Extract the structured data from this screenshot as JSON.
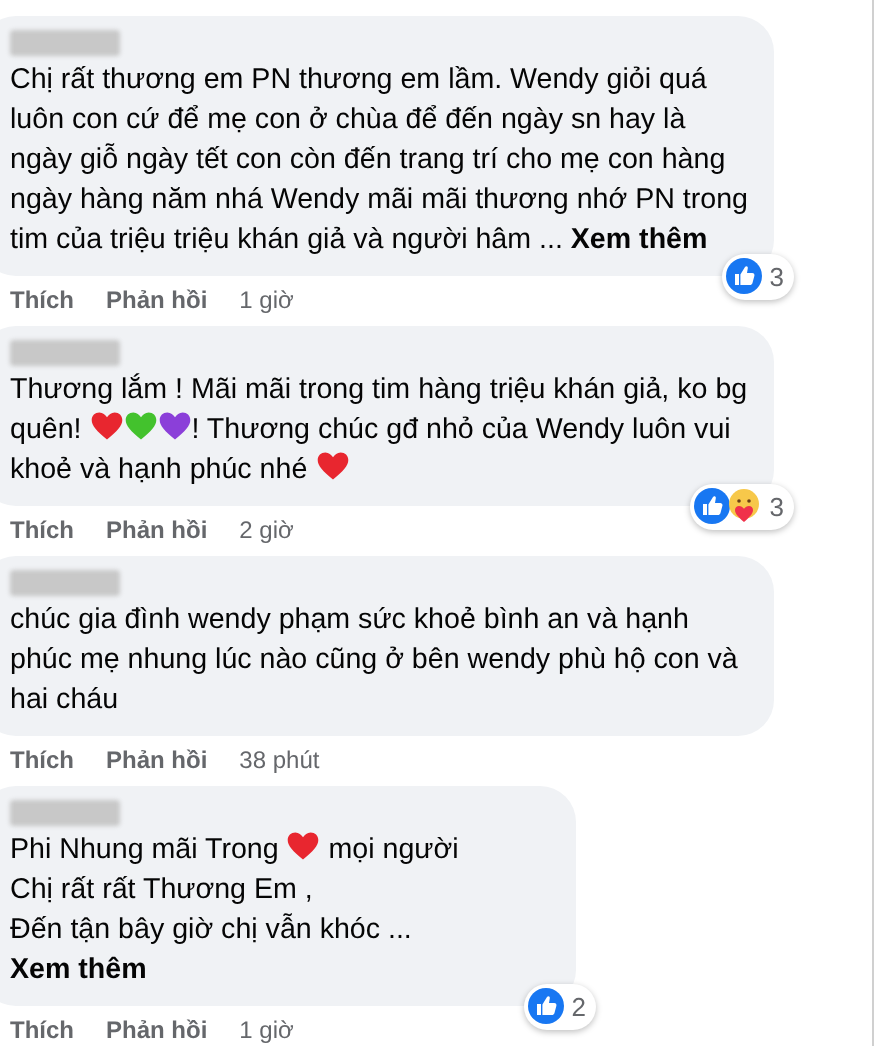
{
  "comments": [
    {
      "content": [
        {
          "kind": "text",
          "text": "Chị rất thương em PN thương em lầm. Wendy giỏi quá luôn con cứ để mẹ con ở chùa để đến ngày sn hay là ngày giỗ ngày tết con còn đến trang trí cho mẹ con hàng ngày hàng năm nhá Wendy mãi mãi thương nhớ PN trong tim của triệu triệu khán giả và người hâm ... "
        },
        {
          "kind": "more",
          "text": "Xem thêm"
        }
      ],
      "actions": [
        "Thích",
        "Phản hồi"
      ],
      "time": "1 giờ",
      "reactions": {
        "icons": [
          {
            "kind": "like"
          }
        ],
        "count": "3"
      }
    },
    {
      "content": [
        {
          "kind": "text",
          "text": "Thương lắm ! Mãi mãi trong tim hàng triệu khán giả, ko bg quên! "
        },
        {
          "kind": "heart",
          "color": "#e8262f"
        },
        {
          "kind": "heart",
          "color": "#43c22d"
        },
        {
          "kind": "heart",
          "color": "#8b3fd9"
        },
        {
          "kind": "text",
          "text": "! Thương chúc gđ nhỏ của Wendy luôn vui khoẻ và hạnh phúc nhé "
        },
        {
          "kind": "heart",
          "color": "#e8262f"
        }
      ],
      "actions": [
        "Thích",
        "Phản hồi"
      ],
      "time": "2 giờ",
      "reactions": {
        "icons": [
          {
            "kind": "like"
          },
          {
            "kind": "care"
          }
        ],
        "count": "3"
      }
    },
    {
      "content": [
        {
          "kind": "text",
          "text": "chúc gia đình wendy phạm sức khoẻ bình an và hạnh phúc mẹ nhung lúc nào cũng ở bên wendy phù hộ con và hai cháu"
        }
      ],
      "actions": [
        "Thích",
        "Phản hồi"
      ],
      "time": "38 phút"
    },
    {
      "content": [
        {
          "kind": "text",
          "text": "Phi Nhung mãi Trong "
        },
        {
          "kind": "heart",
          "color": "#e8262f"
        },
        {
          "kind": "text",
          "text": " mọi người"
        },
        {
          "kind": "break"
        },
        {
          "kind": "text",
          "text": "Chị rất rất Thương Em ,"
        },
        {
          "kind": "break"
        },
        {
          "kind": "text",
          "text": "Đến tận bây giờ chị vẫn khóc ... "
        },
        {
          "kind": "more",
          "text": "Xem thêm"
        }
      ],
      "actions": [
        "Thích",
        "Phản hồi"
      ],
      "time": "1 giờ",
      "reactions": {
        "icons": [
          {
            "kind": "like"
          }
        ],
        "count": "2"
      }
    }
  ]
}
